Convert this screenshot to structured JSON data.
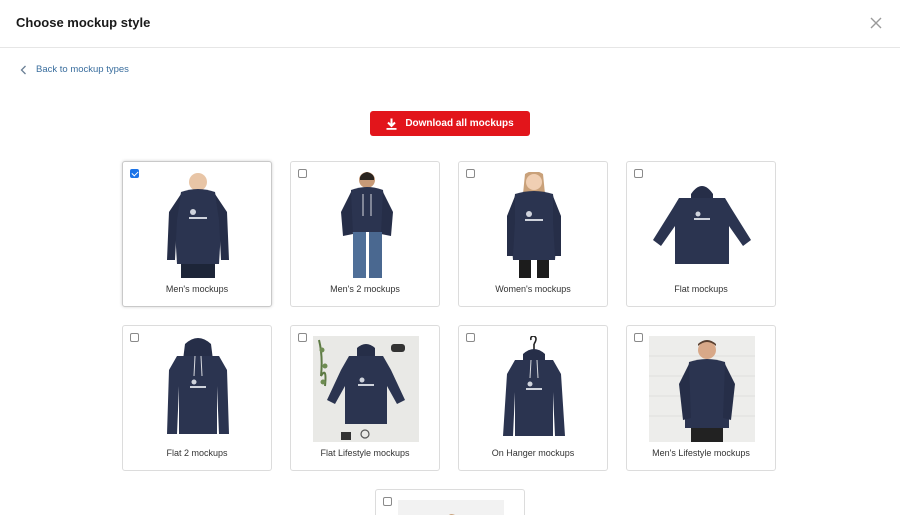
{
  "modal": {
    "title": "Choose mockup style",
    "back_label": "Back to mockup types",
    "download_label": "Download all mockups"
  },
  "colors": {
    "accent": "#e2151b",
    "link": "#3a6e9e",
    "checkbox_checked": "#1a73e8",
    "hoodie": "#2b3450"
  },
  "mockups": [
    {
      "label": "Men's mockups",
      "checked": true,
      "icon": "hoodie-model-icon"
    },
    {
      "label": "Men's 2 mockups",
      "checked": false,
      "icon": "hoodie-model-icon"
    },
    {
      "label": "Women's mockups",
      "checked": false,
      "icon": "hoodie-model-icon"
    },
    {
      "label": "Flat mockups",
      "checked": false,
      "icon": "hoodie-flat-icon"
    },
    {
      "label": "Flat 2 mockups",
      "checked": false,
      "icon": "hoodie-flat-icon"
    },
    {
      "label": "Flat Lifestyle mockups",
      "checked": false,
      "icon": "hoodie-flat-icon"
    },
    {
      "label": "On Hanger mockups",
      "checked": false,
      "icon": "hoodie-hanger-icon"
    },
    {
      "label": "Men's Lifestyle mockups",
      "checked": false,
      "icon": "hoodie-model-icon"
    }
  ]
}
